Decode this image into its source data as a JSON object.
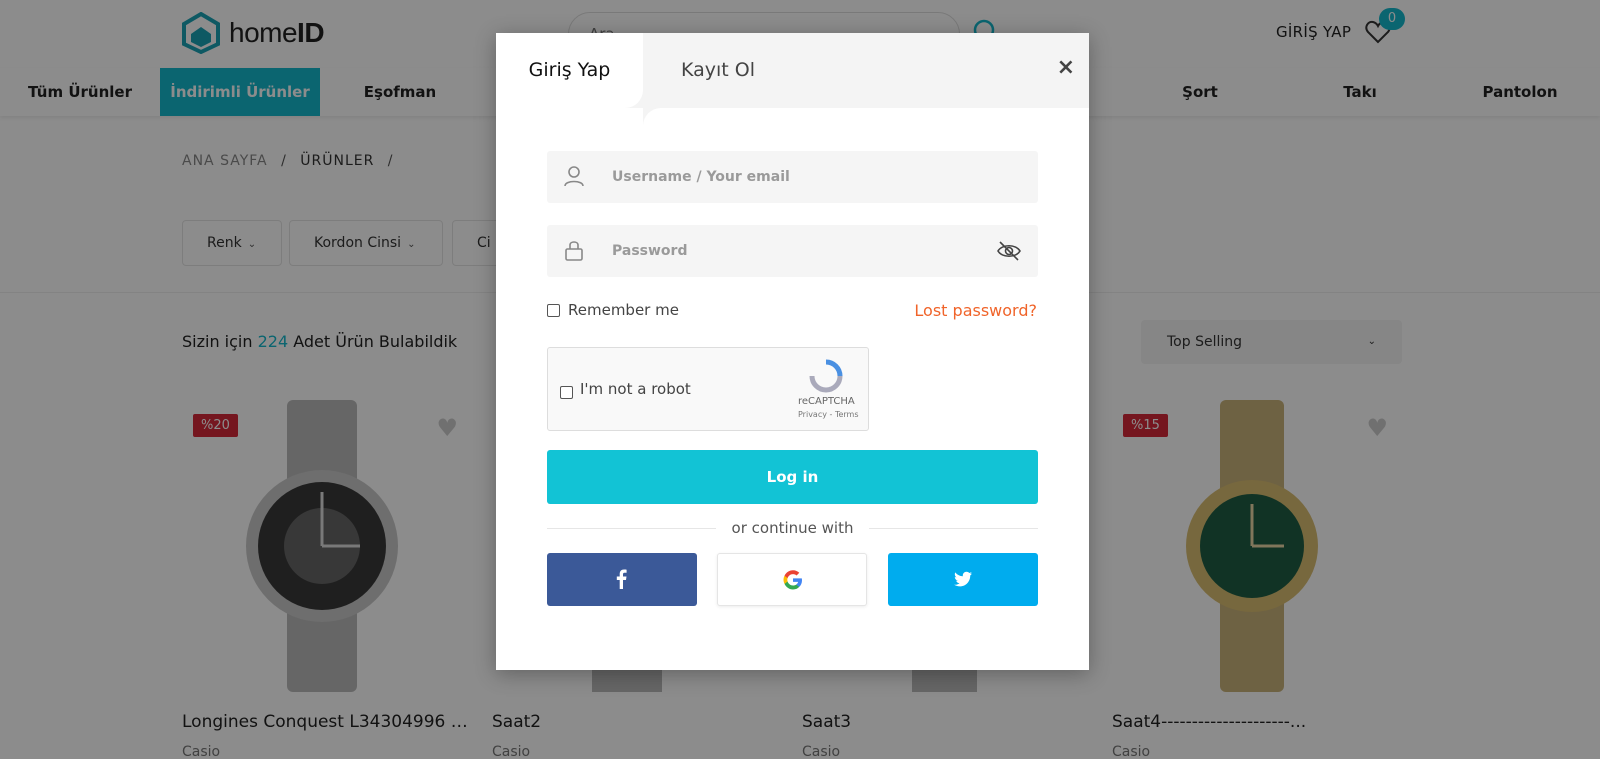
{
  "header": {
    "logo_text_light": "home",
    "logo_text_bold": "ID",
    "search_placeholder": "Ara",
    "login_link": "GİRİŞ YAP",
    "fav_count": "0"
  },
  "nav": {
    "items": [
      {
        "label": "Tüm Ürünler"
      },
      {
        "label": "İndirimli Ürünler",
        "active": true
      },
      {
        "label": "Eşofman"
      },
      {
        "label": "Şort"
      },
      {
        "label": "Takı"
      },
      {
        "label": "Pantolon"
      }
    ]
  },
  "breadcrumb": {
    "home": "ANA SAYFA",
    "separator": "/",
    "current": "ÜRÜNLER"
  },
  "filters": [
    "Renk",
    "Kordon Cinsi",
    "Ci"
  ],
  "results": {
    "prefix": "Sizin için",
    "count": "224",
    "suffix": "Adet Ürün Bulabildik"
  },
  "sort": {
    "selected": "Top Selling"
  },
  "products": [
    {
      "name": "Longines Conquest L34304996 K...",
      "brand": "Casio",
      "discount": "%20"
    },
    {
      "name": "Saat2",
      "brand": "Casio",
      "discount": ""
    },
    {
      "name": "Saat3",
      "brand": "Casio",
      "discount": ""
    },
    {
      "name": "Saat4---------------------...",
      "brand": "Casio",
      "discount": "%15"
    }
  ],
  "modal": {
    "tab_login": "Giriş Yap",
    "tab_register": "Kayıt Ol",
    "close": "×",
    "username_placeholder": "Username / Your email",
    "password_placeholder": "Password",
    "remember": "Remember me",
    "lost_password": "Lost password?",
    "captcha_label": "I'm not a robot",
    "captcha_brand": "reCAPTCHA",
    "captcha_links": "Privacy - Terms",
    "login_button": "Log in",
    "or_text": "or continue with"
  },
  "colors": {
    "accent": "#14b8cc",
    "login_button": "#12c3d5",
    "lost_password": "#f0642a",
    "facebook": "#3b5998",
    "twitter": "#00acee",
    "discount_badge": "#d6283a"
  }
}
